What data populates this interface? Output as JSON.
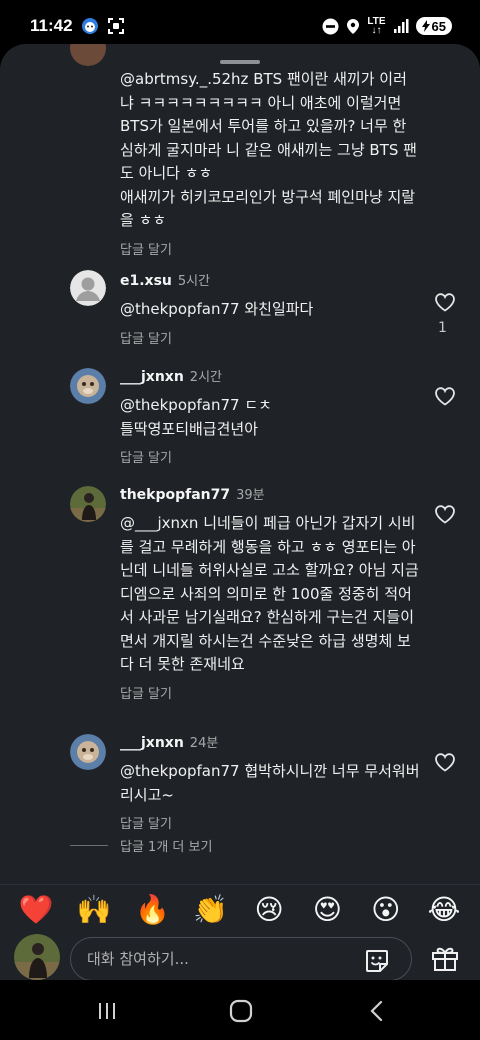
{
  "status_bar": {
    "time": "11:42",
    "lte_top": "LTE",
    "lte_bottom": "↓↑",
    "battery": "65",
    "icons": [
      "app-badge-icon",
      "screenshot-icon",
      "dnd-icon",
      "location-icon",
      "signal-icon",
      "battery-icon"
    ]
  },
  "comments": [
    {
      "user": "",
      "time": "",
      "text": "@abrtmsy._.52hz BTS 팬이란 새끼가 이러냐 ㅋㅋㅋㅋㅋㅋㅋㅋㅋ 아니 애초에 이럴거면 BTS가 일본에서 투어를 하고 있을까? 너무 한심하게 굴지마라 니 같은 애새끼는 그냥 BTS 팬도 아니다 ㅎㅎ\n애새끼가 히키코모리인가 방구석 폐인마냥 지랄을 ㅎㅎ",
      "reply": "답글 달기",
      "likes": ""
    },
    {
      "user": "e1.xsu",
      "time": "5시간",
      "text": "@thekpopfan77 와친일파다",
      "reply": "답글 달기",
      "likes": "1"
    },
    {
      "user": "___jxnxn",
      "time": "2시간",
      "text": "@thekpopfan77 ㄷㅊ\n틀딱영포티배급견년아",
      "reply": "답글 달기",
      "likes": ""
    },
    {
      "user": "thekpopfan77",
      "time": "39분",
      "text": "@___jxnxn 니네들이 페급 아닌가 갑자기 시비를 걸고 무례하게 행동을 하고 ㅎㅎ 영포티는 아닌데 니네들 허위사실로 고소 할까요? 아님 지금 디엠으로 사죄의 의미로 한 100줄 정중히 적어서 사과문 남기실래요? 한심하게 구는건 지들이면서 개지릴 하시는건 수준낮은 하급 생명체 보다 더 못한 존재네요",
      "reply": "답글 달기",
      "likes": ""
    },
    {
      "user": "___jxnxn",
      "time": "24분",
      "text": "@thekpopfan77 협박하시니깐 너무 무서워버리시고~",
      "reply": "답글 달기",
      "likes": ""
    }
  ],
  "more_replies": "답글 1개 더 보기",
  "reactions": [
    "❤️",
    "🙌",
    "🔥",
    "👏",
    "😢",
    "😍",
    "😮",
    "😂"
  ],
  "composer": {
    "placeholder": "대화 참여하기..."
  },
  "colors": {
    "sheet_bg": "#1f2328",
    "text": "#f5f5f5",
    "muted": "#a8a8a8"
  }
}
